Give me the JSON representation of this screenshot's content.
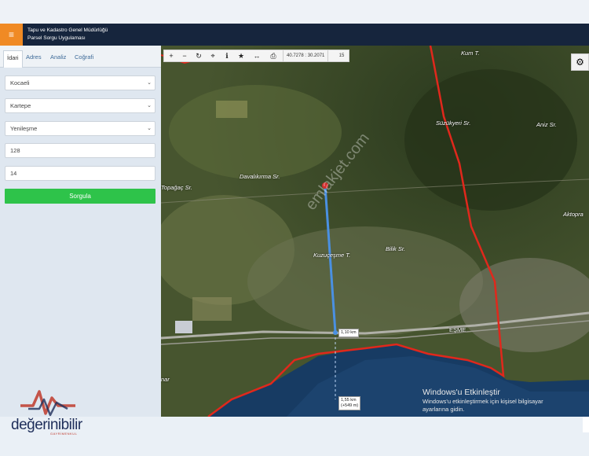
{
  "header": {
    "menu_icon": "hamburger-icon",
    "title_line1": "Tapu ve Kadastro Genel Müdürlüğü",
    "title_line2": "Parsel Sorgu Uygulaması",
    "color": "#16253d",
    "accent": "#f08a24"
  },
  "sidebar": {
    "tabs": [
      "İdari",
      "Adres",
      "Analiz",
      "Coğrafi"
    ],
    "active_tab": "İdari",
    "province": "Kocaeli",
    "district": "Kartepe",
    "neighborhood": "Yenileşme",
    "block": "128",
    "parcel": "14",
    "submit_label": "Sorgula",
    "submit_color": "#2ec34a"
  },
  "toolbar": {
    "buttons": [
      "plus-icon",
      "minus-icon",
      "refresh-icon",
      "locate-icon",
      "info-icon",
      "star-icon",
      "measure-icon",
      "print-icon"
    ],
    "coordinates": "40.7278 : 30.2071",
    "zoom": "15"
  },
  "map": {
    "labels": {
      "kum": "Kum T.",
      "suzuk": "Süzükyeri Sr.",
      "aniz": "Aniz Sr.",
      "aktop": "Aktopra",
      "topagac": "Topağaç Sr.",
      "davali": "Davalıkırma Sr.",
      "kuzu": "Kuzuçeşme T.",
      "bilik": "Bilik Sr.",
      "esme": "EŞME",
      "nar": "nar"
    },
    "dist1": "1,10 km",
    "dist2_line1": "1,55 km",
    "dist2_line2": "(+549 m)",
    "watermark": "emlakjet.com"
  },
  "windows": {
    "title": "Windows'u Etkinleştir",
    "line1": "Windows'u etkinleştirmek için kişisel bilgisayar",
    "line2": "ayarlarına gidin."
  },
  "logo": {
    "name": "değerinibilir",
    "sub": "GAYRİMENKUL"
  }
}
